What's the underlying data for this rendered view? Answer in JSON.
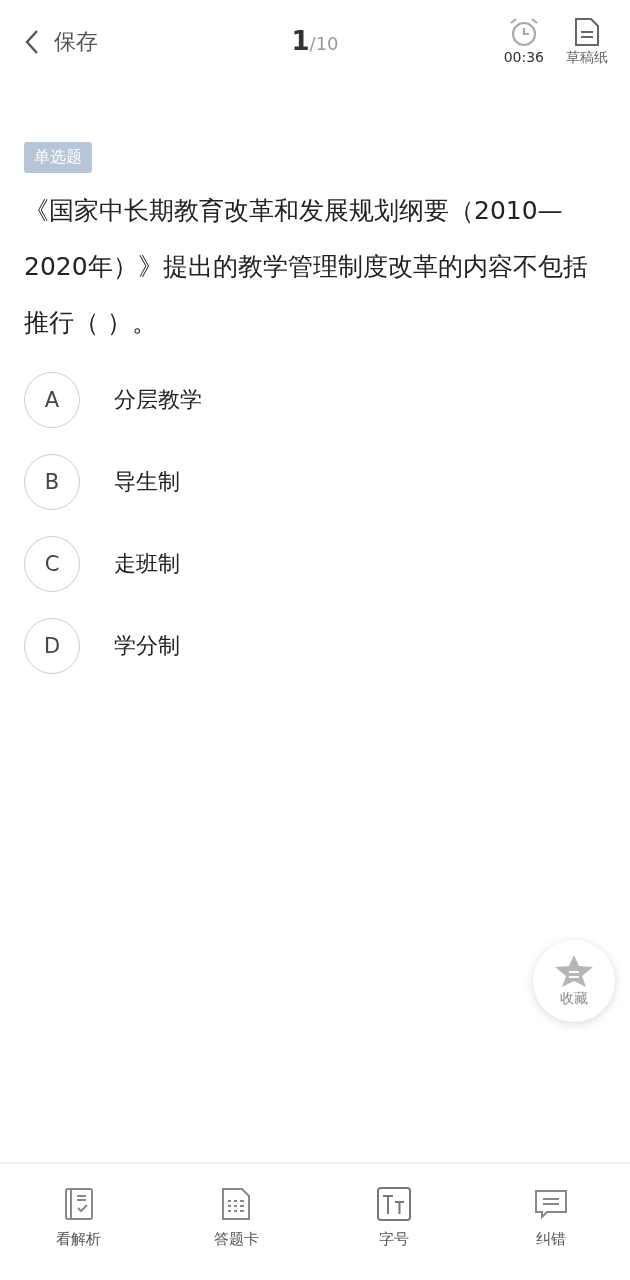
{
  "header": {
    "back": "保存",
    "current": "1",
    "total": "/10",
    "timer": "00:36",
    "scratch": "草稿纸"
  },
  "question": {
    "type": "单选题",
    "text": "《国家中长期教育改革和发展规划纲要（2010—2020年）》提出的教学管理制度改革的内容不包括推行（  ）。"
  },
  "options": [
    {
      "letter": "A",
      "text": "分层教学",
      "selected": false
    },
    {
      "letter": "B",
      "text": "导生制",
      "selected": false
    },
    {
      "letter": "C",
      "text": "走班制",
      "selected": false
    },
    {
      "letter": "D",
      "text": "学分制",
      "selected": false
    }
  ],
  "favorite": {
    "label": "收藏",
    "on": false
  },
  "toolbar": [
    {
      "kind": "analysis",
      "label": "看解析"
    },
    {
      "kind": "card",
      "label": "答题卡"
    },
    {
      "kind": "font",
      "label": "字号"
    },
    {
      "kind": "report",
      "label": "纠错"
    }
  ]
}
